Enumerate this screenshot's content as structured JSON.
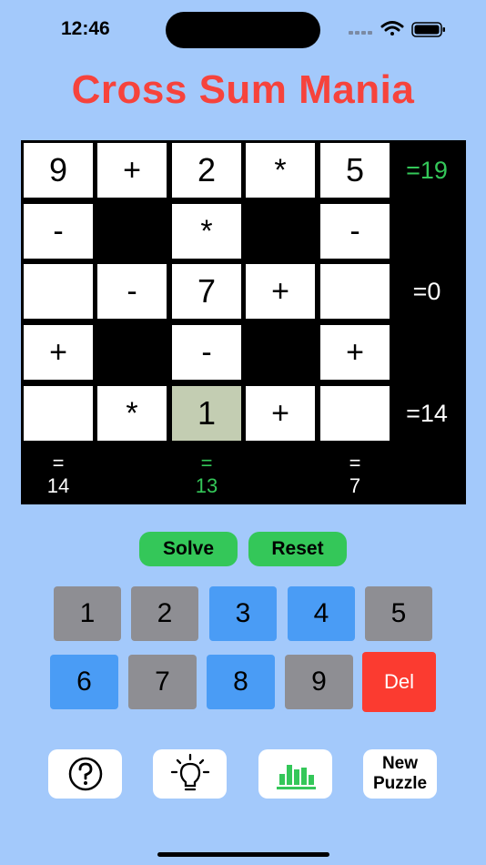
{
  "status": {
    "time": "12:46"
  },
  "title": "Cross Sum Mania",
  "colors": {
    "title": "#f6433c",
    "correct": "#34c759",
    "selected_cell": "#c3cdb2",
    "key_gray": "#8e8e93",
    "key_blue": "#4a9cf5",
    "delete": "#fb3b30",
    "background": "#a3c9fb"
  },
  "grid": {
    "cells": [
      {
        "r": 0,
        "c": 0,
        "v": "9",
        "type": "number"
      },
      {
        "r": 0,
        "c": 1,
        "v": "+",
        "type": "op"
      },
      {
        "r": 0,
        "c": 2,
        "v": "2",
        "type": "number"
      },
      {
        "r": 0,
        "c": 3,
        "v": "*",
        "type": "op"
      },
      {
        "r": 0,
        "c": 4,
        "v": "5",
        "type": "number"
      },
      {
        "r": 1,
        "c": 0,
        "v": "-",
        "type": "op"
      },
      {
        "r": 1,
        "c": 2,
        "v": "*",
        "type": "op"
      },
      {
        "r": 1,
        "c": 4,
        "v": "-",
        "type": "op"
      },
      {
        "r": 2,
        "c": 0,
        "v": "",
        "type": "number"
      },
      {
        "r": 2,
        "c": 1,
        "v": "-",
        "type": "op"
      },
      {
        "r": 2,
        "c": 2,
        "v": "7",
        "type": "number"
      },
      {
        "r": 2,
        "c": 3,
        "v": "+",
        "type": "op"
      },
      {
        "r": 2,
        "c": 4,
        "v": "",
        "type": "number"
      },
      {
        "r": 3,
        "c": 0,
        "v": "+",
        "type": "op"
      },
      {
        "r": 3,
        "c": 2,
        "v": "-",
        "type": "op"
      },
      {
        "r": 3,
        "c": 4,
        "v": "+",
        "type": "op"
      },
      {
        "r": 4,
        "c": 0,
        "v": "",
        "type": "number"
      },
      {
        "r": 4,
        "c": 1,
        "v": "*",
        "type": "op"
      },
      {
        "r": 4,
        "c": 2,
        "v": "1",
        "type": "number",
        "selected": true
      },
      {
        "r": 4,
        "c": 3,
        "v": "+",
        "type": "op"
      },
      {
        "r": 4,
        "c": 4,
        "v": "",
        "type": "number"
      }
    ],
    "row_sums": [
      {
        "row": 0,
        "label": "=19",
        "correct": true
      },
      {
        "row": 2,
        "label": "=0",
        "correct": false
      },
      {
        "row": 4,
        "label": "=14",
        "correct": false
      }
    ],
    "col_sums": [
      {
        "col": 0,
        "eq": "=",
        "value": "14",
        "correct": false
      },
      {
        "col": 2,
        "eq": "=",
        "value": "13",
        "correct": true
      },
      {
        "col": 4,
        "eq": "=",
        "value": "7",
        "correct": false
      }
    ]
  },
  "actions": {
    "solve": "Solve",
    "reset": "Reset"
  },
  "keypad": [
    {
      "label": "1",
      "color": "gray"
    },
    {
      "label": "2",
      "color": "gray"
    },
    {
      "label": "3",
      "color": "blue"
    },
    {
      "label": "4",
      "color": "blue"
    },
    {
      "label": "5",
      "color": "gray"
    },
    {
      "label": "6",
      "color": "blue"
    },
    {
      "label": "7",
      "color": "gray"
    },
    {
      "label": "8",
      "color": "blue"
    },
    {
      "label": "9",
      "color": "gray"
    },
    {
      "label": "Del",
      "color": "del"
    }
  ],
  "toolbar": {
    "help_icon": "question-mark-circle-icon",
    "hint_icon": "lightbulb-icon",
    "stats_icon": "bar-chart-icon",
    "new_puzzle_line1": "New",
    "new_puzzle_line2": "Puzzle"
  }
}
